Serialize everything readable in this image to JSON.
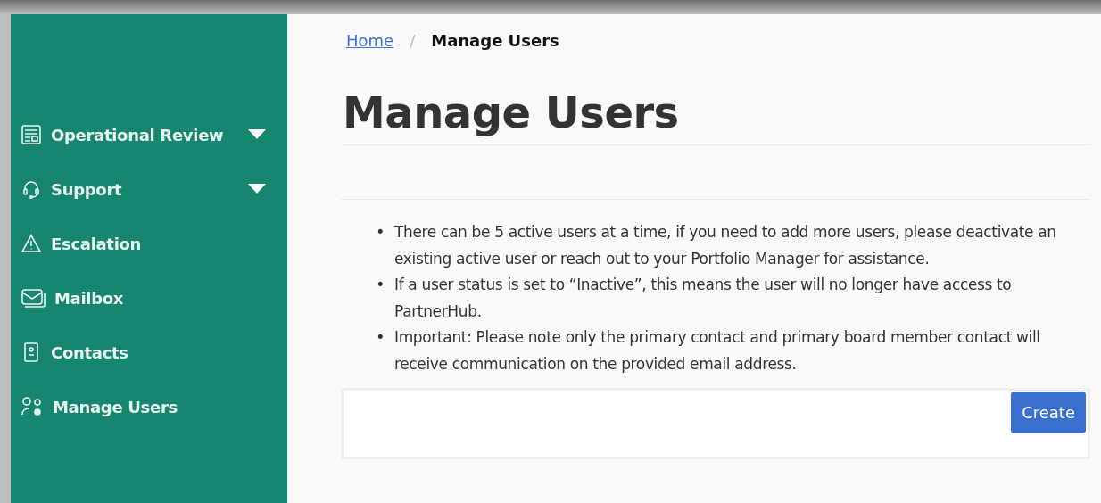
{
  "sidebar": {
    "items": [
      {
        "label": "Operational Review",
        "expandable": true
      },
      {
        "label": "Support",
        "expandable": true
      },
      {
        "label": "Escalation",
        "expandable": false
      },
      {
        "label": "Mailbox",
        "expandable": false
      },
      {
        "label": "Contacts",
        "expandable": false
      },
      {
        "label": "Manage Users",
        "expandable": false
      }
    ]
  },
  "breadcrumb": {
    "link": "Home",
    "separator": "/",
    "current": "Manage Users"
  },
  "title": "Manage Users",
  "notes": [
    {
      "bullet": "•",
      "text": "There can be 5 active users at a time, if you need to add more users, please deactivate an existing active user or reach out to your Portfolio Manager for assistance."
    },
    {
      "bullet": "•",
      "text": "If a user status is set to “Inactive”, this means the user will no longer have access to PartnerHub."
    },
    {
      "bullet": "•",
      "text": "Important: Please note only the primary contact and primary board member contact will receive communication on the provided email address."
    }
  ],
  "create_button": "Create"
}
